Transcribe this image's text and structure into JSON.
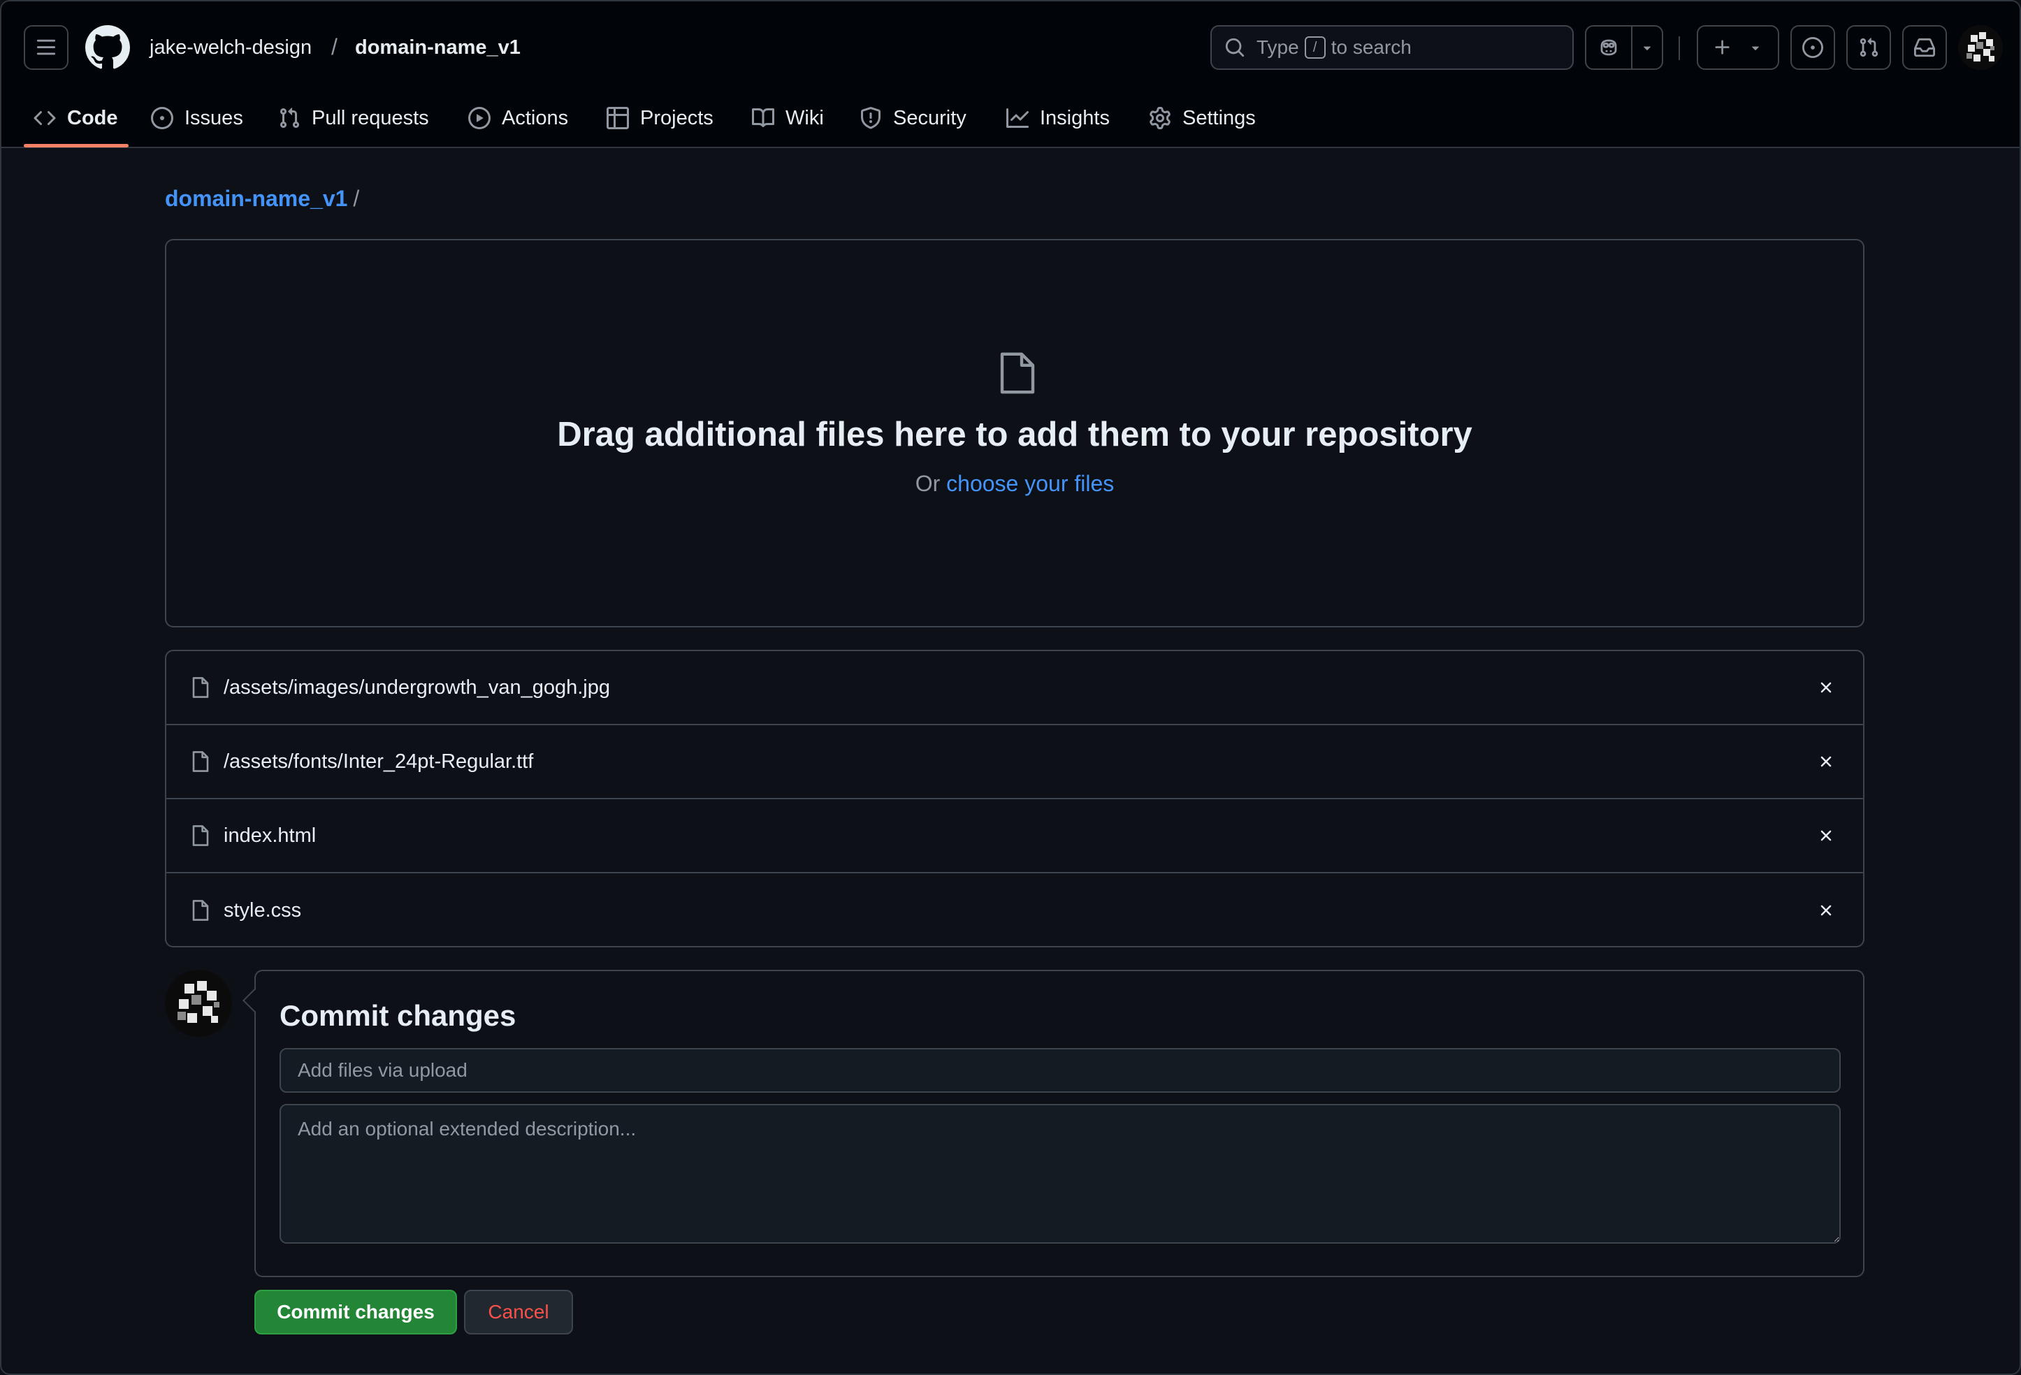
{
  "header": {
    "owner": "jake-welch-design",
    "separator": "/",
    "repo": "domain-name_v1",
    "search": {
      "prefix": "Type",
      "key": "/",
      "suffix": "to search"
    }
  },
  "tabs": [
    {
      "label": "Code",
      "icon": "code-icon"
    },
    {
      "label": "Issues",
      "icon": "issue-opened-icon"
    },
    {
      "label": "Pull requests",
      "icon": "git-pull-request-icon"
    },
    {
      "label": "Actions",
      "icon": "play-icon"
    },
    {
      "label": "Projects",
      "icon": "table-icon"
    },
    {
      "label": "Wiki",
      "icon": "book-icon"
    },
    {
      "label": "Security",
      "icon": "shield-icon"
    },
    {
      "label": "Insights",
      "icon": "graph-icon"
    },
    {
      "label": "Settings",
      "icon": "gear-icon"
    }
  ],
  "breadcrumb": {
    "repo": "domain-name_v1",
    "slash": "/"
  },
  "dropzone": {
    "title": "Drag additional files here to add them to your repository",
    "or": "Or",
    "link": "choose your files"
  },
  "files": [
    "/assets/images/undergrowth_van_gogh.jpg",
    "/assets/fonts/Inter_24pt-Regular.ttf",
    "index.html",
    "style.css"
  ],
  "commit": {
    "title": "Commit changes",
    "summary_placeholder": "Add files via upload",
    "description_placeholder": "Add an optional extended description...",
    "commit_button": "Commit changes",
    "cancel_button": "Cancel"
  },
  "colors": {
    "background": "#0d1117",
    "header_bg": "#010409",
    "link": "#4493f8",
    "accent_underline": "#f78166",
    "primary_button": "#238636",
    "danger_text": "#f85149"
  }
}
